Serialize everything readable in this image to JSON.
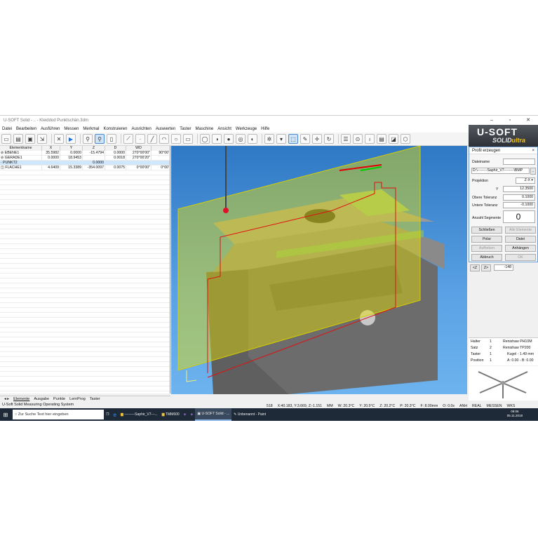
{
  "window": {
    "title": "U-SOFT Solid - .. - Kleiddod Punktschän.3dm"
  },
  "menu": [
    "Datei",
    "Bearbeiten",
    "Ausführen",
    "Messen",
    "Merkmal",
    "Konstruieren",
    "Ausrichten",
    "Auswerten",
    "Taster",
    "Maschine",
    "Ansicht",
    "Werkzeuge",
    "Hilfe"
  ],
  "logo": {
    "line1": "U-SOFT",
    "line2": "SOLID",
    "line3": "ultra"
  },
  "table": {
    "headers": [
      "Elementname",
      "X",
      "Y",
      "Z",
      "D",
      "WD",
      ""
    ],
    "rows": [
      {
        "name": "EBENE1",
        "x": "35.5982",
        "y": "0.0000",
        "z": "-15.4794",
        "d": "0.0000",
        "wd": "270°00'00\"",
        "e": "90°00'"
      },
      {
        "name": "GERADE1",
        "x": "0.0000",
        "y": "18.9453",
        "z": "",
        "d": "0.0018",
        "wd": "270°00'20\"",
        "e": ""
      },
      {
        "name": "PUNKT2",
        "x": "",
        "y": "",
        "z": "0.0000",
        "d": "",
        "wd": "",
        "e": ""
      },
      {
        "name": "FLÄCHE1",
        "x": "4.6409",
        "y": "15.3389",
        "z": "-354.0097",
        "d": "0.0075",
        "wd": "0°00'00\"",
        "e": "0°00'"
      }
    ]
  },
  "tabs": [
    "Elemente",
    "Ausgabe",
    "Punkte",
    "LernProg",
    "Taster"
  ],
  "status_left": "U-Soft Solid Measuring Operating System",
  "statusbar": [
    "518",
    "X:40.183, Y:3.669, Z:-1.151",
    "MM",
    "W: 20.3°C",
    "Y: 20.5°C",
    "Z: 20.2°C",
    "P: 20.3°C",
    "F: 8.00mm",
    "O: 0.0s",
    "ANH",
    "REAL",
    "MESSEN",
    "WKS"
  ],
  "profile": {
    "title": "Profil erzeugen",
    "dateiname_label": "Dateiname",
    "path": "D:\\--------Saphir_V7--------\\BMP",
    "projektion_label": "Projektion",
    "projektion_value": "Z-X",
    "y_label": "Y",
    "y_value": "12.3500",
    "obere_label": "Obere Toleranz",
    "obere_value": "0.1000",
    "untere_label": "Untere Toleranz",
    "untere_value": "-0.1000",
    "segmente_label": "Anzahl Segmente",
    "segmente_value": "0",
    "buttons": [
      "Schließen",
      "Alle Elemente",
      "Polar",
      "Datei",
      "Aufheben",
      "Anhängen",
      "Abbruch",
      "OK"
    ]
  },
  "zcontrols": {
    "z_minus": "<Z",
    "z_plus": "Z>",
    "value": "-148"
  },
  "probe": {
    "rows": [
      {
        "label": "Halter",
        "num": "1",
        "val": "Renishaw PH10M"
      },
      {
        "label": "Satz",
        "num": "2",
        "val": "Renishaw TP200"
      },
      {
        "label": "Taster",
        "num": "1",
        "val": "Kugel - 1.49 mm"
      },
      {
        "label": "Position",
        "num": "1",
        "val": "A: 0.00 - B: 0.00"
      }
    ]
  },
  "taskbar": {
    "search_placeholder": "Zur Suche Text hier eingeben",
    "items": [
      "---------Saphir_V7---...",
      "TMM600",
      "U-SOFT Solid - ...",
      "Unbenannt - Paint"
    ],
    "time": "09:06",
    "date": "05.11.2018"
  }
}
